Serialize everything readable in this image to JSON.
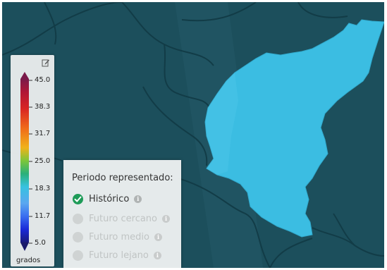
{
  "map": {
    "background_color": "#1c4f5c",
    "region_color": "#3bbde2",
    "border_color": "#123c47"
  },
  "legend": {
    "ticks": [
      "45.0",
      "38.3",
      "31.7",
      "25.0",
      "18.3",
      "11.7",
      "5.0"
    ],
    "unit": "grados",
    "edit_icon": "edit-icon"
  },
  "period": {
    "title": "Periodo representado:",
    "options": [
      {
        "label": "Histórico",
        "selected": true
      },
      {
        "label": "Futuro cercano",
        "selected": false
      },
      {
        "label": "Futuro medio",
        "selected": false
      },
      {
        "label": "Futuro lejano",
        "selected": false
      }
    ],
    "info_icon": "info-icon"
  }
}
